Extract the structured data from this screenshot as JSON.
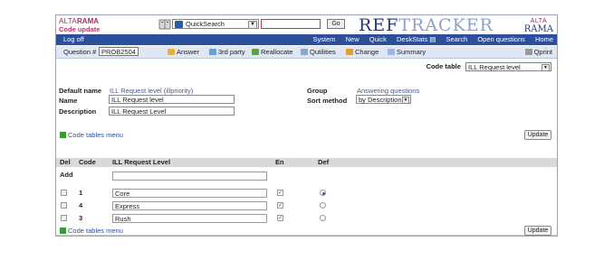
{
  "brand": {
    "alta": "ALTA",
    "rama": "RAMA",
    "subtitle": "Code update"
  },
  "quicksearch": {
    "selected": "QuickSearch",
    "value": "",
    "go_label": "Go"
  },
  "product": {
    "ref": "REF",
    "tracker": "TRACKER",
    "alta": "ALTA",
    "rama": "RAMA"
  },
  "nav": {
    "logoff": "Log off",
    "items": [
      "System",
      "New",
      "Quick",
      "DeskStats",
      "Search",
      "Open questions",
      "Home"
    ]
  },
  "toolbar": {
    "question_label": "Question #",
    "question_value": "PROB2504",
    "actions": [
      "Answer",
      "3rd party",
      "Reallocate",
      "Qutilities",
      "Change",
      "Summary"
    ],
    "print_label": "Qprint"
  },
  "codetable": {
    "label": "Code table",
    "selected": "ILL Request level"
  },
  "form": {
    "default_name_label": "Default name",
    "default_name_value": "ILL Request level (illpriority)",
    "name_label": "Name",
    "name_value": "ILL Request level",
    "description_label": "Description",
    "description_value": "ILL Request Level",
    "group_label": "Group",
    "group_value": "Answering questions",
    "sort_label": "Sort method",
    "sort_value": "by Description"
  },
  "menu_link": "Code tables menu",
  "update_label": "Update",
  "table": {
    "headers": {
      "del": "Del",
      "code": "Code",
      "level": "ILL Request Level",
      "en": "En",
      "def": "Def"
    },
    "add_label": "Add",
    "rows": [
      {
        "code": "1",
        "text": "Core",
        "enabled": true,
        "default": true
      },
      {
        "code": "4",
        "text": "Express",
        "enabled": true,
        "default": false
      },
      {
        "code": "3",
        "text": "Rush",
        "enabled": true,
        "default": false
      }
    ]
  }
}
